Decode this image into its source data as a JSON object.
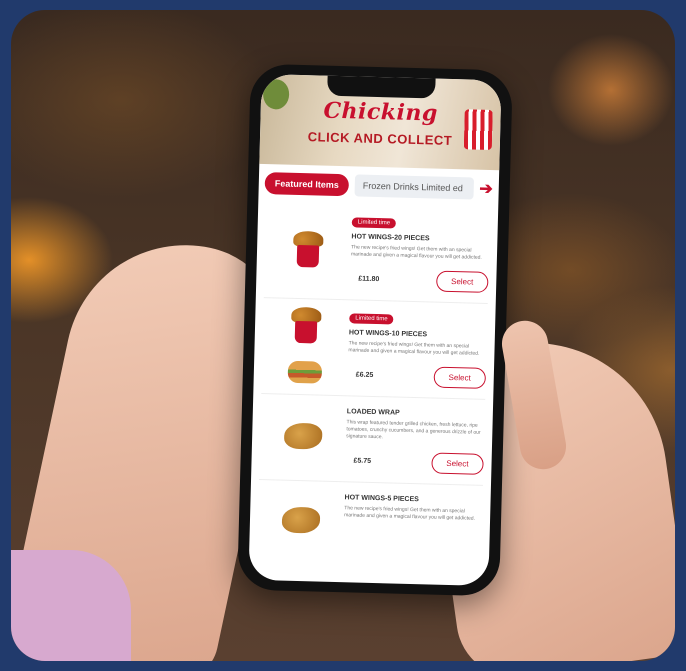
{
  "app": {
    "logo_text": "Chicking",
    "tagline": "CLICK AND COLLECT"
  },
  "tabs": {
    "active_label": "Featured Items",
    "next_label": "Frozen Drinks Limited ed"
  },
  "items": [
    {
      "badge": "Limited time",
      "title": "HOT WINGS-20 PIECES",
      "desc": "The new recipe's fried wings! Get them with an special marinade and given a magical flavour you will get addicted.",
      "price": "£11.80",
      "button": "Select",
      "image": "bucket"
    },
    {
      "badge": "Limited time",
      "title": "HOT WINGS-10 PIECES",
      "desc": "The new recipe's fried wings! Get them with an special marinade and given a magical flavour you will get addicted.",
      "price": "£6.25",
      "button": "Select",
      "image": "bucket"
    },
    {
      "badge": "",
      "title": "LOADED WRAP",
      "desc": "This wrap featured tender grilled chicken, fresh lettuce, ripe tomatoes, crunchy cucumbers, and a generous drizzle of our signature sauce.",
      "price": "£5.75",
      "button": "Select",
      "image": "wrap"
    },
    {
      "badge": "",
      "title": "HOT WINGS-5 PIECES",
      "desc": "The new recipe's fried wings! Get them with an special marinade and given a magical flavour you will get addicted.",
      "price": "",
      "button": "",
      "image": "bucket"
    }
  ]
}
